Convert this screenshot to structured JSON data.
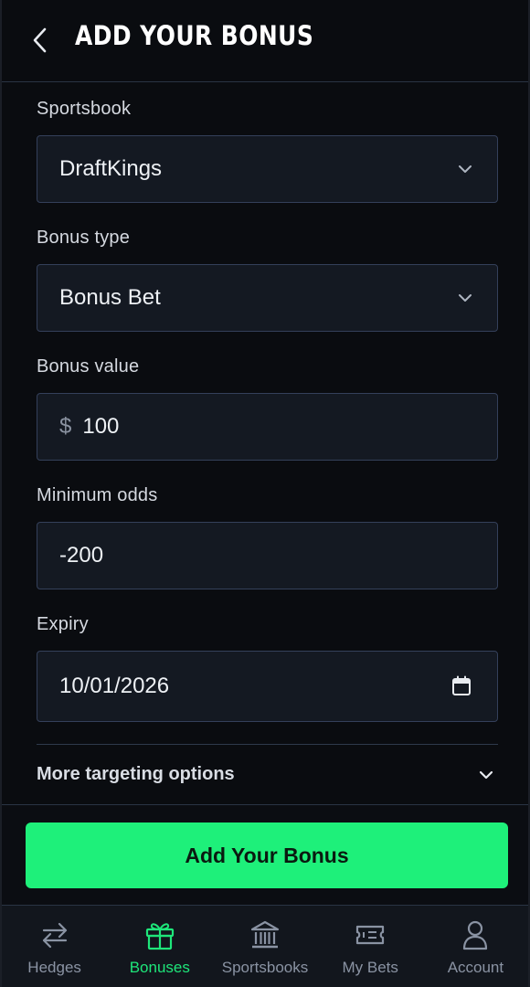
{
  "header": {
    "title": "ADD YOUR BONUS",
    "back_icon": "chevron-left-icon"
  },
  "form": {
    "sportsbook": {
      "label": "Sportsbook",
      "value": "DraftKings"
    },
    "bonus_type": {
      "label": "Bonus type",
      "value": "Bonus Bet"
    },
    "bonus_value": {
      "label": "Bonus value",
      "currency": "$",
      "value": "100"
    },
    "minimum_odds": {
      "label": "Minimum odds",
      "value": "-200"
    },
    "expiry": {
      "label": "Expiry",
      "value": "10/01/2026"
    },
    "more_options": {
      "label": "More targeting options"
    }
  },
  "submit": {
    "label": "Add Your Bonus"
  },
  "nav": {
    "items": [
      {
        "label": "Hedges",
        "icon": "arrows-swap-icon",
        "active": false
      },
      {
        "label": "Bonuses",
        "icon": "gift-icon",
        "active": true
      },
      {
        "label": "Sportsbooks",
        "icon": "bank-icon",
        "active": false
      },
      {
        "label": "My Bets",
        "icon": "ticket-icon",
        "active": false
      },
      {
        "label": "Account",
        "icon": "user-icon",
        "active": false
      }
    ]
  },
  "colors": {
    "background": "#0a0c10",
    "accent": "#1ef07a",
    "field_bg": "#141922",
    "field_border": "#34405a",
    "nav_inactive": "#8a93a3",
    "nav_active": "#1ee67a"
  }
}
